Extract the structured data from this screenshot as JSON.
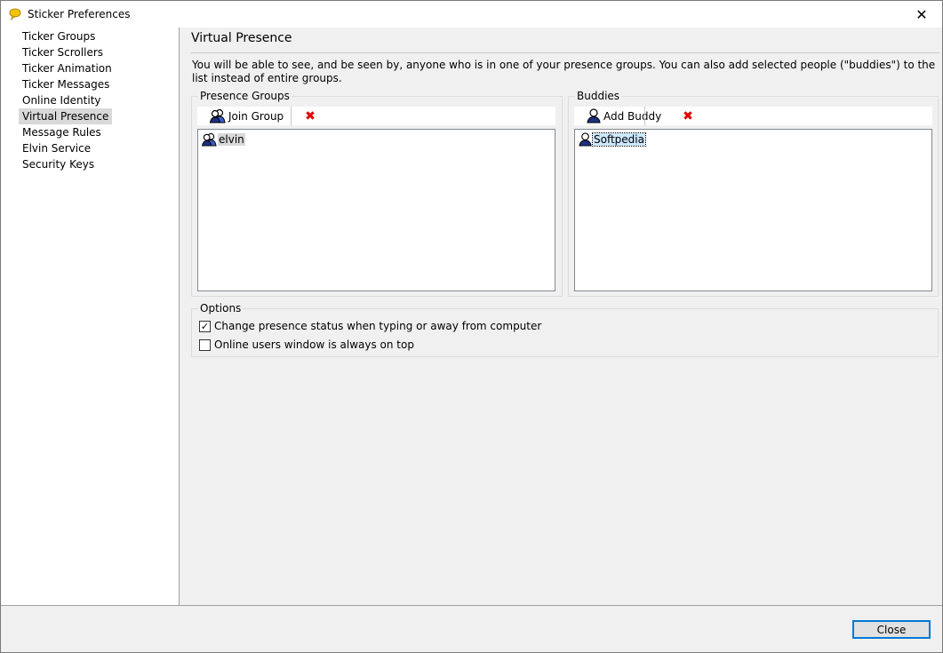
{
  "window": {
    "title": "Sticker Preferences",
    "close_glyph": "✕"
  },
  "sidebar": {
    "items": [
      {
        "label": "Ticker Groups"
      },
      {
        "label": "Ticker Scrollers"
      },
      {
        "label": "Ticker Animation"
      },
      {
        "label": "Ticker Messages"
      },
      {
        "label": "Online Identity"
      },
      {
        "label": "Virtual Presence",
        "selected": true
      },
      {
        "label": "Message Rules"
      },
      {
        "label": "Elvin Service"
      },
      {
        "label": "Security Keys"
      }
    ]
  },
  "page": {
    "heading": "Virtual Presence",
    "description": "You will be able to see, and be seen by, anyone who is in one of your presence groups. You can also add selected people (\"buddies\") to the list instead of entire groups."
  },
  "presence_groups": {
    "label": "Presence Groups",
    "join_label": "Join Group",
    "delete_glyph": "✖",
    "items": [
      {
        "label": "elvin"
      }
    ]
  },
  "buddies": {
    "label": "Buddies",
    "add_label": "Add Buddy",
    "delete_glyph": "✖",
    "items": [
      {
        "label": "Softpedia"
      }
    ]
  },
  "options": {
    "label": "Options",
    "change_status": {
      "label": "Change presence status when typing or away from computer",
      "checked": true,
      "mark": "✓"
    },
    "always_on_top": {
      "label": "Online users window is always on top",
      "checked": false,
      "mark": ""
    }
  },
  "footer": {
    "close_label": "Close"
  },
  "colors": {
    "delete": "#e00000",
    "focus_border": "#0078d7",
    "selection": "#cce8ff"
  }
}
